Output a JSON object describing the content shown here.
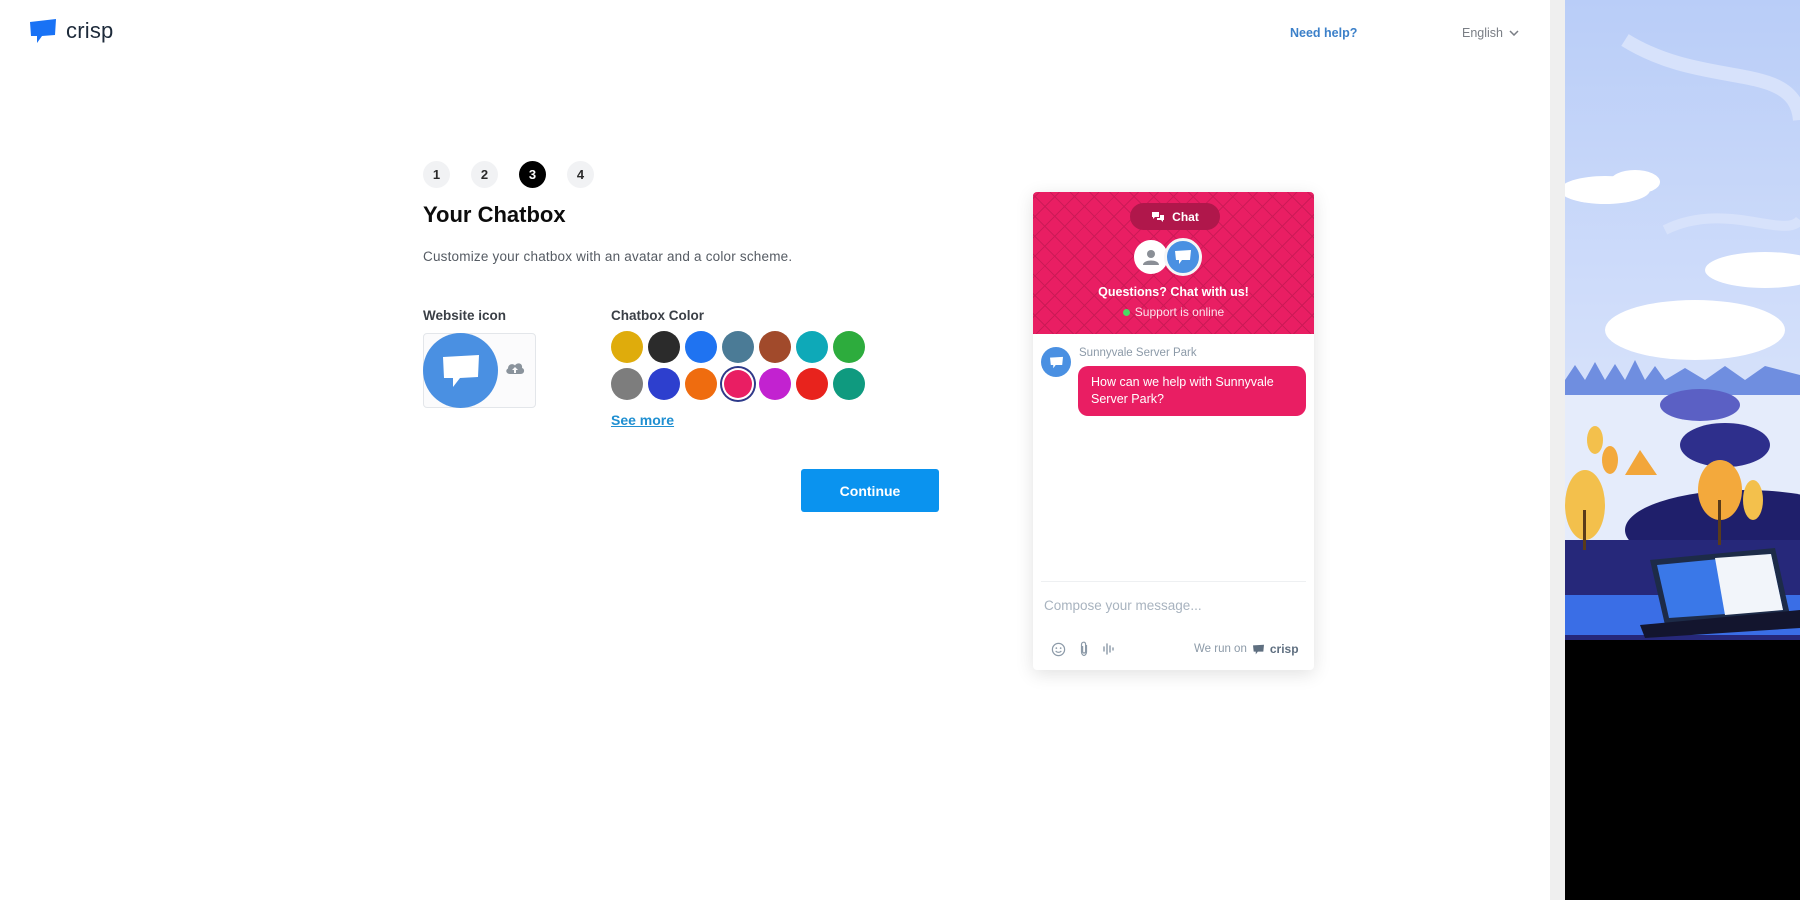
{
  "header": {
    "logo_text": "crisp",
    "help_link": "Need help?",
    "language": "English"
  },
  "steps": [
    "1",
    "2",
    "3",
    "4"
  ],
  "active_step": "3",
  "page": {
    "title": "Your Chatbox",
    "subtitle": "Customize your chatbox with an avatar and a color scheme."
  },
  "website_icon": {
    "label": "Website icon",
    "upload_icon": "cloud-upload-icon"
  },
  "chatbox_color": {
    "label": "Chatbox Color",
    "swatches": [
      {
        "name": "yellow",
        "hex": "#dfac0c"
      },
      {
        "name": "black",
        "hex": "#2b2b2b"
      },
      {
        "name": "blue",
        "hex": "#1f73f1"
      },
      {
        "name": "steel-blue",
        "hex": "#4b7b96"
      },
      {
        "name": "brown",
        "hex": "#a14a2b"
      },
      {
        "name": "teal",
        "hex": "#0ea9b8"
      },
      {
        "name": "green",
        "hex": "#2dac3d"
      },
      {
        "name": "gray",
        "hex": "#7d7d7d"
      },
      {
        "name": "royal-blue",
        "hex": "#2d3fce"
      },
      {
        "name": "orange",
        "hex": "#ef6c0f"
      },
      {
        "name": "pink",
        "hex": "#e91e63",
        "selected": true
      },
      {
        "name": "purple",
        "hex": "#c222d0"
      },
      {
        "name": "red",
        "hex": "#e8231d"
      },
      {
        "name": "dark-teal",
        "hex": "#0f9a7f"
      }
    ],
    "see_more": "See more"
  },
  "continue_button": "Continue",
  "chat_preview": {
    "tab_label": "Chat",
    "headline": "Questions? Chat with us!",
    "status": "Support is online",
    "operator_name": "Sunnyvale Server Park",
    "message": "How can we help with Sunnyvale Server Park?",
    "compose_placeholder": "Compose your message...",
    "run_on_text": "We run on",
    "run_on_brand": "crisp",
    "accent": "#e91e63"
  }
}
